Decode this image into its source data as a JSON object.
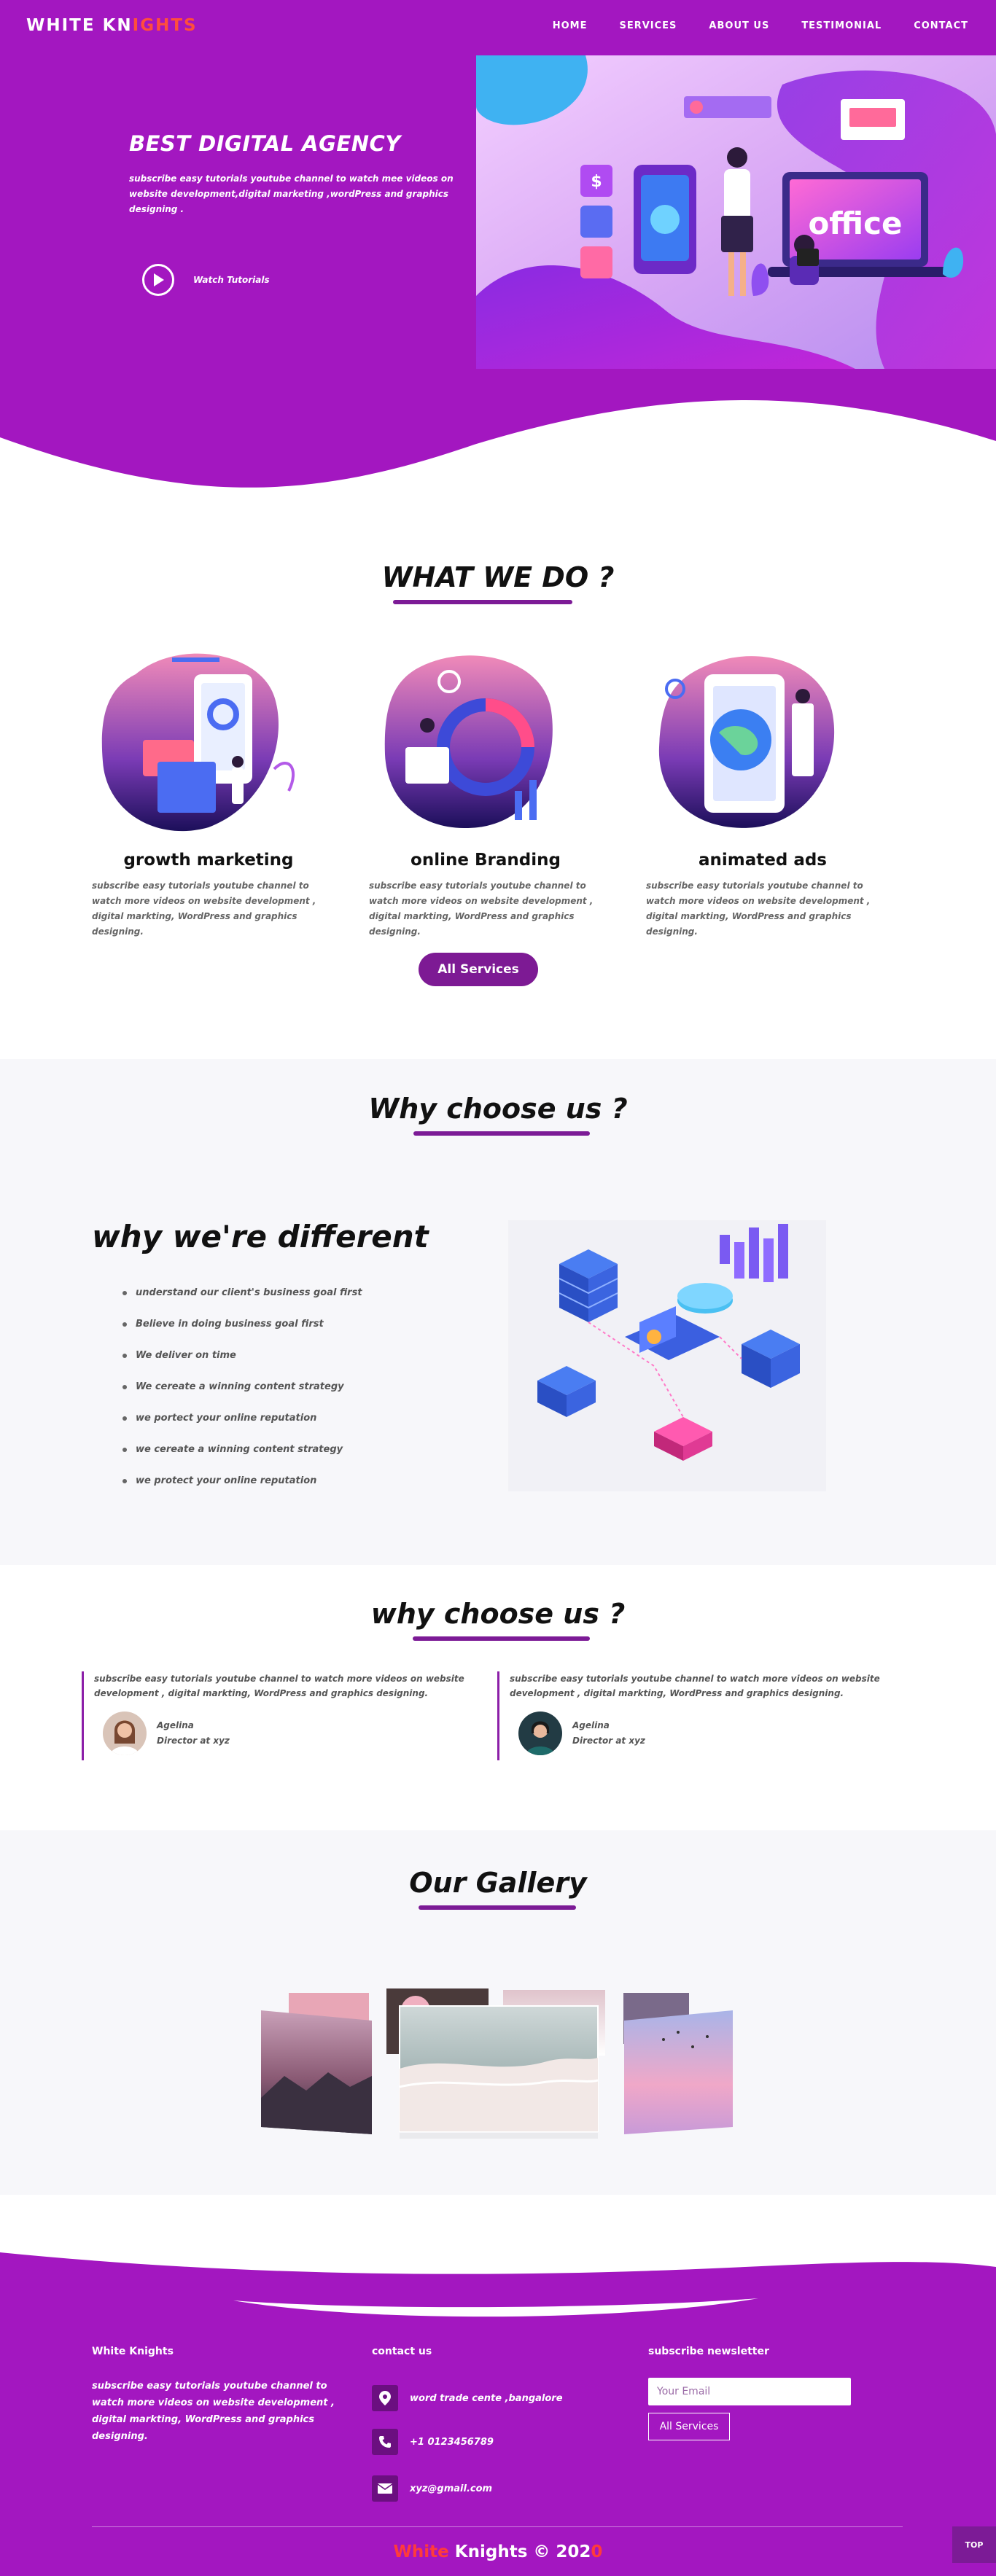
{
  "brand": {
    "name_part1": "WHITE KN",
    "name_part2": "IGHTS"
  },
  "nav": {
    "items": [
      "HOME",
      "SERVICES",
      "ABOUT US",
      "TESTIMONIAL",
      "CONTACT"
    ]
  },
  "hero": {
    "title": "BEST DIGITAL AGENCY",
    "text": "subscribe easy tutorials youtube channel to watch mee videos on website development,digital marketing ,wordPress and graphics designing .",
    "watch_label": "Watch Tutorials",
    "illustration_text": "office"
  },
  "what_we_do": {
    "title": "WHAT WE DO ?",
    "services": [
      {
        "name": "growth marketing",
        "desc": "subscribe easy tutorials youtube channel to watch more videos on website development , digital markting, WordPress and graphics designing."
      },
      {
        "name": "online Branding",
        "desc": "subscribe easy tutorials youtube channel to watch more videos on website development , digital markting, WordPress and graphics designing."
      },
      {
        "name": "animated ads",
        "desc": "subscribe easy tutorials youtube channel to watch more videos on website development , digital markting, WordPress and graphics designing."
      }
    ],
    "button_label": "All Services"
  },
  "why_choose": {
    "title": "Why choose us ?",
    "subtitle": "why we're different",
    "points": [
      "understand our client's business goal first",
      "Believe in doing business goal first",
      "We deliver on time",
      "We cereate a winning content strategy",
      "we portect your online reputation",
      "we cereate a winning content strategy",
      "we protect your online reputation"
    ]
  },
  "testimonials": {
    "title": "why choose us ?",
    "items": [
      {
        "text": "subscribe easy tutorials youtube channel to watch more videos on website development , digital markting, WordPress and graphics designing.",
        "name": "Agelina",
        "role": "Director at xyz"
      },
      {
        "text": "subscribe easy tutorials youtube channel to watch more videos on website development , digital markting, WordPress and graphics designing.",
        "name": "Agelina",
        "role": "Director at xyz"
      }
    ]
  },
  "gallery": {
    "title": "Our Gallery"
  },
  "footer": {
    "col1_title": "White Knights",
    "col1_text": "subscribe easy tutorials youtube channel to watch more videos on website development , digital markting, WordPress and graphics designing.",
    "col2_title": "contact us",
    "address": "word trade cente ,bangalore",
    "phone": "+1 0123456789",
    "email": "xyz@gmail.com",
    "col3_title": "subscribe newsletter",
    "email_placeholder": "Your Email",
    "subscribe_button": "All Services",
    "copyright_part1": "White ",
    "copyright_part2": "Kn",
    "copyright_part3": "ights © 202",
    "copyright_part4": "0",
    "top_label": "TOP"
  },
  "colors": {
    "primary": "#a317c0",
    "dark_purple": "#7c1b96",
    "accent_red": "#ff4d3d"
  }
}
